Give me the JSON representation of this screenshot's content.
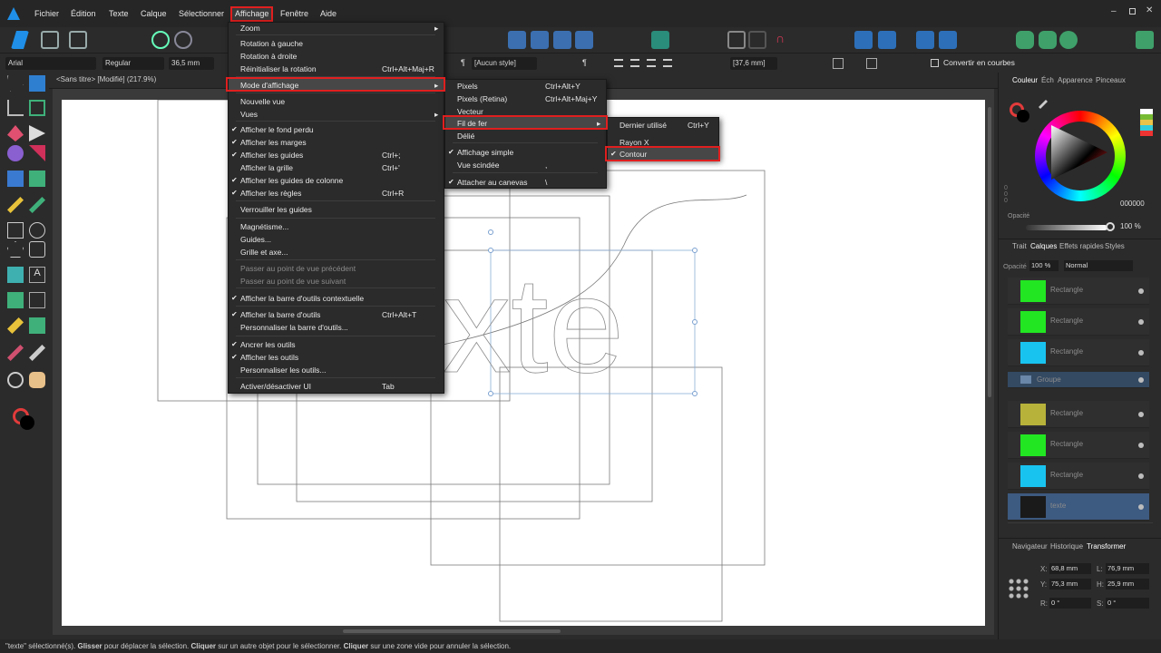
{
  "menubar": {
    "items": [
      "Fichier",
      "Édition",
      "Texte",
      "Calque",
      "Sélectionner",
      "Affichage",
      "Fenêtre",
      "Aide"
    ]
  },
  "context": {
    "font": "Arial",
    "style": "Regular",
    "size": "36,5 mm",
    "para_style": "[Aucun style]",
    "line": "[37,6 mm]",
    "convert": "Convertir en courbes",
    "pilcrow": "¶"
  },
  "doc_tab": {
    "title": "<Sans titre> [Modifié] (217.9%)"
  },
  "status": {
    "selected": "\"texte\" sélectionné(s). ",
    "drag": "Glisser",
    "drag_rest": " pour déplacer la sélection. ",
    "click": "Cliquer",
    "click_rest": " sur un autre objet pour le sélectionner. ",
    "click2": "Cliquer",
    "click2_rest": " sur une zone vide pour annuler la sélection."
  },
  "affichage_menu": [
    {
      "label": "Zoom",
      "submenu": true
    },
    {
      "label": "Rotation à gauche"
    },
    {
      "label": "Rotation à droite"
    },
    {
      "label": "Réinitialiser la rotation",
      "shortcut": "Ctrl+Alt+Maj+R"
    },
    {
      "label": "Mode d'affichage",
      "submenu": true,
      "active": true
    },
    {
      "label": "Nouvelle vue"
    },
    {
      "label": "Vues",
      "submenu": true
    },
    {
      "label": "Afficher le fond perdu",
      "checked": true
    },
    {
      "label": "Afficher les marges",
      "checked": true
    },
    {
      "label": "Afficher les guides",
      "checked": true,
      "shortcut": "Ctrl+;"
    },
    {
      "label": "Afficher la grille",
      "shortcut": "Ctrl+'"
    },
    {
      "label": "Afficher les guides de colonne",
      "checked": true
    },
    {
      "label": "Afficher les règles",
      "checked": true,
      "shortcut": "Ctrl+R"
    },
    {
      "label": "Verrouiller les guides"
    },
    {
      "label": "Magnétisme..."
    },
    {
      "label": "Guides..."
    },
    {
      "label": "Grille et axe..."
    },
    {
      "label": "Passer au point de vue précédent",
      "disabled": true
    },
    {
      "label": "Passer au point de vue suivant",
      "disabled": true
    },
    {
      "label": "Afficher la barre d'outils contextuelle",
      "checked": true
    },
    {
      "label": "Afficher la barre d'outils",
      "checked": true,
      "shortcut": "Ctrl+Alt+T"
    },
    {
      "label": "Personnaliser la barre d'outils..."
    },
    {
      "label": "Ancrer les outils",
      "checked": true
    },
    {
      "label": "Afficher les outils",
      "checked": true
    },
    {
      "label": "Personnaliser les outils..."
    },
    {
      "label": "Activer/désactiver UI",
      "shortcut": "Tab"
    }
  ],
  "mode_menu": [
    {
      "label": "Pixels",
      "shortcut": "Ctrl+Alt+Y"
    },
    {
      "label": "Pixels (Retina)",
      "shortcut": "Ctrl+Alt+Maj+Y"
    },
    {
      "label": "Vecteur"
    },
    {
      "label": "Fil de fer",
      "submenu": true,
      "active": true
    },
    {
      "label": "Délié"
    },
    {
      "label": "Affichage simple",
      "checked": true
    },
    {
      "label": "Vue scindée",
      "shortcut": ","
    },
    {
      "label": "Attacher au canevas",
      "checked": true,
      "shortcut": "\\"
    }
  ],
  "wire_menu": [
    {
      "label": "Dernier utilisé",
      "shortcut": "Ctrl+Y"
    },
    {
      "label": "Rayon X"
    },
    {
      "label": "Contour",
      "checked": true,
      "active": true
    }
  ],
  "color_panel": {
    "tabs": [
      "Couleur",
      "Éch",
      "Apparence",
      "Pinceaux"
    ],
    "hex": "000000",
    "opacity_label": "Opacité",
    "opacity": "100 %",
    "hsl_labels": [
      "H",
      "S",
      "L"
    ],
    "hsl_values": [
      "0",
      "0",
      "0"
    ]
  },
  "layers_panel": {
    "tabs": [
      "Trait",
      "Calques",
      "Effets rapides",
      "Styles"
    ],
    "opacity_label": "Opacité",
    "opacity": "100 %",
    "blend": "Normal",
    "layers": [
      {
        "name": "Rectangle",
        "color": "#22e622"
      },
      {
        "name": "Rectangle",
        "color": "#22e622"
      },
      {
        "name": "Rectangle",
        "color": "#19c3f0"
      },
      {
        "name": "Groupe",
        "color": "group"
      },
      {
        "name": "Rectangle",
        "color": "#b7b23a"
      },
      {
        "name": "Rectangle",
        "color": "#22e622"
      },
      {
        "name": "Rectangle",
        "color": "#19c3f0"
      },
      {
        "name": "texte",
        "color": "text",
        "selected": true
      }
    ]
  },
  "transform_panel": {
    "tabs": [
      "Navigateur",
      "Historique",
      "Transformer"
    ],
    "x_label": "X:",
    "x": "68,8 mm",
    "y_label": "Y:",
    "y": "75,3 mm",
    "w_label": "L:",
    "w": "76,9 mm",
    "h_label": "H:",
    "h": "25,9 mm",
    "r_label": "R:",
    "r": "0 °",
    "s_label": "S:",
    "s": "0 °"
  },
  "canvas": {
    "text": "xte"
  },
  "colors": {
    "accent": "#e01f1f",
    "selection": "#3d5a80",
    "green": "#22e622",
    "cyan": "#19c3f0",
    "olive": "#b7b23a"
  }
}
